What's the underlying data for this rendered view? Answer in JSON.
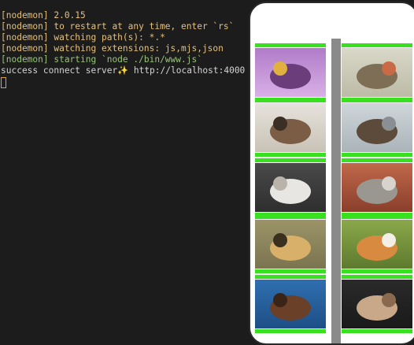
{
  "terminal": {
    "lines": [
      {
        "text": "[nodemon] 2.0.15",
        "color": "yellow"
      },
      {
        "text": "[nodemon] to restart at any time, enter `rs`",
        "color": "yellow"
      },
      {
        "text": "[nodemon] watching path(s): *.*",
        "color": "yellow"
      },
      {
        "text": "[nodemon] watching extensions: js,mjs,json",
        "color": "yellow"
      },
      {
        "text": "[nodemon] starting `node ./bin/www.js`",
        "color": "green"
      },
      {
        "text": "success connect server✨ http://localhost:4000",
        "color": "white"
      }
    ]
  },
  "gallery": {
    "images": [
      {
        "subject": "bee on purple thistle flower",
        "palette": [
          "#b07bc8",
          "#d8b0e6",
          "#6b3d7a",
          "#e0b040"
        ]
      },
      {
        "subject": "small bird on branch",
        "palette": [
          "#d9d8c9",
          "#bcbba6",
          "#7e6e55",
          "#c86a45"
        ]
      },
      {
        "subject": "sparrow on ground",
        "palette": [
          "#e6e2dc",
          "#c9c2b6",
          "#7a5d44",
          "#3a2e25"
        ]
      },
      {
        "subject": "tabby cat on wooden table",
        "palette": [
          "#cfd6da",
          "#aab4b9",
          "#5c4a3a",
          "#8a8f93"
        ]
      },
      {
        "subject": "white cat on couch",
        "palette": [
          "#4a4a4a",
          "#2e2e2e",
          "#e8e6e2",
          "#b9b3ab"
        ]
      },
      {
        "subject": "tabby cat lying down",
        "palette": [
          "#c0684a",
          "#8a3f2c",
          "#9a9690",
          "#d8d3cc"
        ]
      },
      {
        "subject": "cheetah cub in grass",
        "palette": [
          "#9c9468",
          "#7a7450",
          "#d8b06a",
          "#3a3020"
        ]
      },
      {
        "subject": "corgi in grass",
        "palette": [
          "#8aa84a",
          "#5e7a2e",
          "#d88a40",
          "#f4efe6"
        ]
      },
      {
        "subject": "brown dog on blue background",
        "palette": [
          "#2f6fb0",
          "#1e4f86",
          "#6a4028",
          "#3a2418"
        ]
      },
      {
        "subject": "curly-haired dog on dark background",
        "palette": [
          "#2a2a2a",
          "#1a1a1a",
          "#c8a888",
          "#8a6a4e"
        ]
      }
    ]
  }
}
